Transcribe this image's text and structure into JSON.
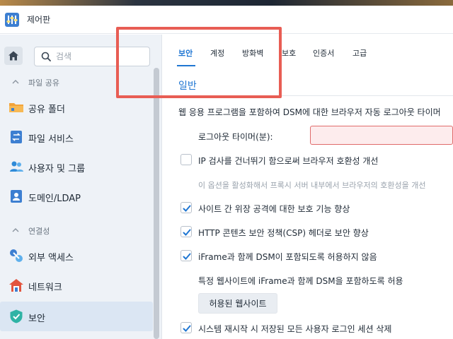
{
  "window": {
    "title": "제어판"
  },
  "colors": {
    "accent": "#1f76d2",
    "annotation": "#e85d54",
    "error_border": "#e06b6b"
  },
  "sidebar": {
    "search": {
      "placeholder": "검색",
      "value": ""
    },
    "sections": [
      {
        "label": "파일 공유",
        "items": [
          {
            "label": "공유 폴더",
            "icon": "folder-icon"
          },
          {
            "label": "파일 서비스",
            "icon": "file-services-icon"
          },
          {
            "label": "사용자 및 그룹",
            "icon": "users-icon"
          },
          {
            "label": "도메인/LDAP",
            "icon": "domain-icon"
          }
        ]
      },
      {
        "label": "연결성",
        "items": [
          {
            "label": "외부 액세스",
            "icon": "external-access-icon"
          },
          {
            "label": "네트워크",
            "icon": "network-icon"
          },
          {
            "label": "보안",
            "icon": "shield-icon",
            "active": true
          }
        ]
      }
    ]
  },
  "tabs": [
    {
      "label": "보안",
      "active": true
    },
    {
      "label": "계정"
    },
    {
      "label": "방화벽"
    },
    {
      "label": "보호"
    },
    {
      "label": "인증서"
    },
    {
      "label": "고급"
    }
  ],
  "main": {
    "section_title": "일반",
    "auto_logout_text": "웹 응용 프로그램을 포함하여 DSM에 대한 브라우저 자동 로그아웃 타이머",
    "logout_timer_label": "로그아웃 타이머(분):",
    "logout_timer_value": "",
    "options": [
      {
        "label": "IP 검사를 건너뛰기 함으로써 브라우저 호환성 개선",
        "checked": false
      },
      {
        "label": "사이트 간 위장 공격에 대한 보호 기능 향상",
        "checked": true
      },
      {
        "label": "HTTP 콘텐츠 보안 정책(CSP) 헤더로 보안 향상",
        "checked": true
      },
      {
        "label": "iFrame과 함께 DSM이 포함되도록 허용하지 않음",
        "checked": true
      },
      {
        "label": "시스템 재시작 시 저장된 모든 사용자 로그인 세션 삭제",
        "checked": true
      }
    ],
    "ip_skip_hint": "이 옵션을 활성화해서 프록시 서버 내부에서 브라우저의 호환성을 개선",
    "iframe_sites_text": "특정 웹사이트에 iFrame과 함께 DSM을 포함하도록 허용",
    "allowed_sites_button": "허용된 웹사이트"
  }
}
